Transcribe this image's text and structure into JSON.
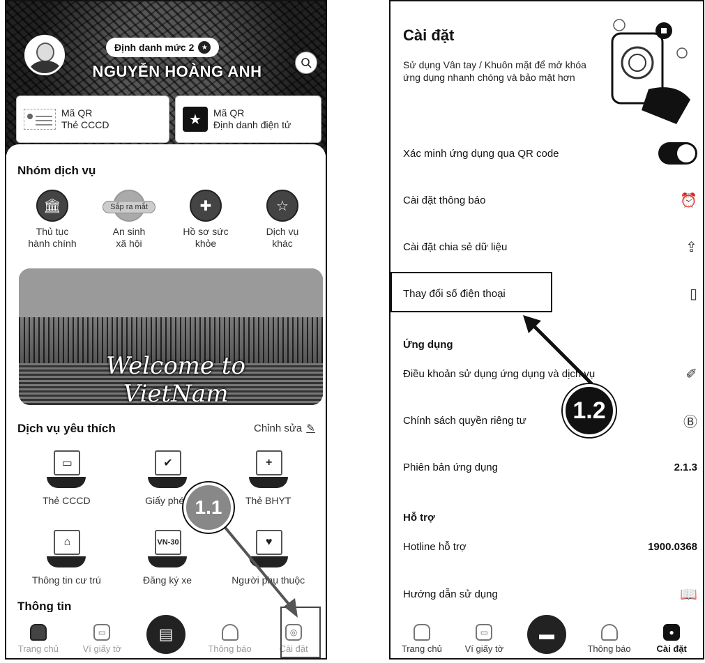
{
  "left": {
    "id_level": "Định danh mức 2",
    "user_name": "NGUYỄN HOÀNG ANH",
    "qr_cards": [
      {
        "line1": "Mã QR",
        "line2": "Thẻ CCCD"
      },
      {
        "line1": "Mã QR",
        "line2": "Định danh điện tử"
      }
    ],
    "service_group_title": "Nhóm dịch vụ",
    "services": [
      {
        "line1": "Thủ tục",
        "line2": "hành chính",
        "icon": "bank-icon"
      },
      {
        "line1": "An sinh",
        "line2": "xã hội",
        "icon": "coming-soon",
        "tag": "Sắp ra mắt"
      },
      {
        "line1": "Hồ sơ sức",
        "line2": "khỏe",
        "icon": "health-icon"
      },
      {
        "line1": "Dịch vụ",
        "line2": "khác",
        "icon": "more-services-icon"
      }
    ],
    "banner_text": "Welcome to VietNam",
    "favorites_title": "Dịch vụ yêu thích",
    "favorites_edit": "Chỉnh sửa",
    "favorites": [
      {
        "label": "Thẻ CCCD",
        "glyph": "▭"
      },
      {
        "label": "Giấy phép",
        "glyph": "✔"
      },
      {
        "label": "Thẻ BHYT",
        "glyph": "+"
      },
      {
        "label": "Thông tin cư trú",
        "glyph": "⌂"
      },
      {
        "label": "Đăng ký xe",
        "glyph": "VN-30"
      },
      {
        "label": "Người phụ thuộc",
        "glyph": "♥"
      }
    ],
    "info_title": "Thông tin",
    "step_label": "1.1",
    "tabs": [
      {
        "label": "Trang chủ",
        "active": false
      },
      {
        "label": "Ví giấy tờ",
        "active": false
      },
      {
        "label": "",
        "center": true
      },
      {
        "label": "Thông báo",
        "active": false
      },
      {
        "label": "Cài đặt",
        "active": false
      }
    ]
  },
  "right": {
    "title": "Cài đặt",
    "description": "Sử dụng Vân tay / Khuôn mặt để mở khóa ứng dụng nhanh chóng và bảo mật hơn",
    "rows": [
      {
        "label": "Xác minh ứng dụng qua QR code",
        "control": "toggle-on"
      },
      {
        "label": "Cài đặt thông báo",
        "icon": "alarm-icon"
      },
      {
        "label": "Cài đặt chia sẻ dữ liệu",
        "icon": "share-icon"
      },
      {
        "label": "Thay đổi số điện thoại",
        "icon": "phone-icon"
      }
    ],
    "app_group": "Ứng dụng",
    "app_rows": [
      {
        "label": "Điều khoản sử dụng ứng dụng và dịch vụ",
        "icon": "ruler-icon"
      },
      {
        "label": "Chính sách quyền riêng tư",
        "icon": "privacy-icon"
      },
      {
        "label": "Phiên bản ứng dụng",
        "value": "2.1.3"
      }
    ],
    "support_group": "Hỗ trợ",
    "support_rows": [
      {
        "label": "Hotline hỗ trợ",
        "value": "1900.0368"
      },
      {
        "label": "Hướng dẫn sử dụng",
        "icon": "book-icon"
      }
    ],
    "step_label": "1.2",
    "tabs": [
      {
        "label": "Trang chủ",
        "active": false
      },
      {
        "label": "Ví giấy tờ",
        "active": false
      },
      {
        "label": "",
        "center": true
      },
      {
        "label": "Thông báo",
        "active": false
      },
      {
        "label": "Cài đặt",
        "active": true
      }
    ]
  }
}
